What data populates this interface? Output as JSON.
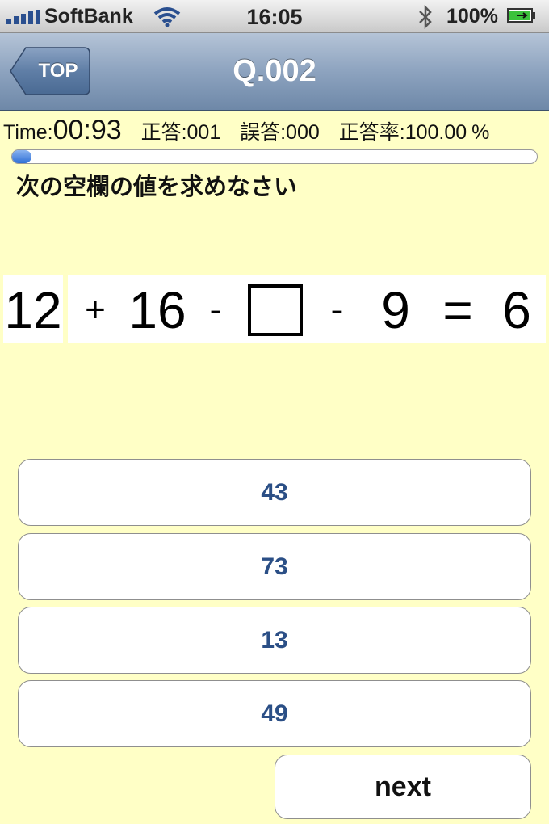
{
  "status_bar": {
    "carrier": "SoftBank",
    "time": "16:05",
    "battery_percent": "100%",
    "icons": [
      "signal-icon",
      "wifi-icon",
      "bluetooth-icon",
      "battery-icon"
    ]
  },
  "nav": {
    "back_label": "TOP",
    "title": "Q.002"
  },
  "stats": {
    "time_label": "Time:",
    "time_value": "00:93",
    "correct_label": "正答:",
    "correct_value": "001",
    "wrong_label": "誤答:",
    "wrong_value": "000",
    "rate_label": "正答率:",
    "rate_value": "100.00",
    "rate_unit": "%"
  },
  "progress": {
    "fraction": 0.03
  },
  "instruction": "次の空欄の値を求めなさい",
  "equation": {
    "term1": "12",
    "op1": "+",
    "term2": "16",
    "op2": "-",
    "op3": "-",
    "term3": "9",
    "equals": "=",
    "result": "6"
  },
  "answers": [
    "43",
    "73",
    "13",
    "49"
  ],
  "next_label": "next",
  "colors": {
    "background": "#ffffc6",
    "answer_text": "#2b4f86",
    "nav_bar": "#8da3bf"
  }
}
